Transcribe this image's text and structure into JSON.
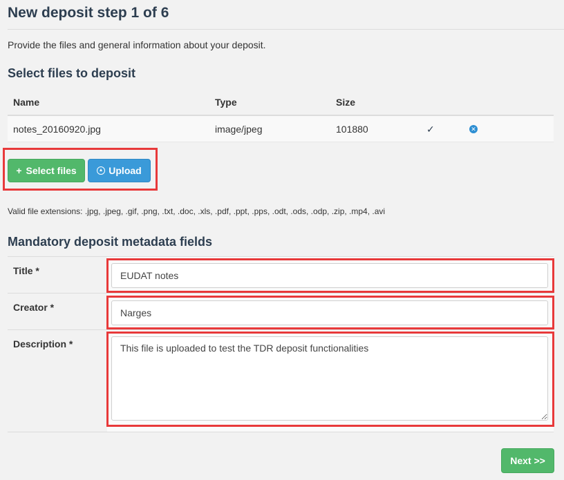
{
  "page": {
    "title": "New deposit step 1 of 6",
    "intro": "Provide the files and general information about your deposit."
  },
  "files": {
    "heading": "Select files to deposit",
    "columns": [
      "Name",
      "Type",
      "Size"
    ],
    "rows": [
      {
        "name": "notes_20160920.jpg",
        "type": "image/jpeg",
        "size": "101880",
        "status": "✓",
        "remove_icon": "remove-circle-icon"
      }
    ],
    "select_button": "Select files",
    "upload_button": "Upload",
    "valid_extensions": "Valid file extensions: .jpg, .jpeg, .gif, .png, .txt, .doc, .xls, .pdf, .ppt, .pps, .odt, .ods, .odp, .zip, .mp4, .avi"
  },
  "metadata": {
    "heading": "Mandatory deposit metadata fields",
    "title_label": "Title *",
    "title_value": "EUDAT notes",
    "creator_label": "Creator *",
    "creator_value": "Narges",
    "description_label": "Description *",
    "description_value": "This file is uploaded to test the TDR deposit functionalities"
  },
  "actions": {
    "next_button": "Next >>"
  },
  "colors": {
    "highlight": "#e8393a",
    "green": "#52b86b",
    "blue": "#3a9ad9"
  }
}
